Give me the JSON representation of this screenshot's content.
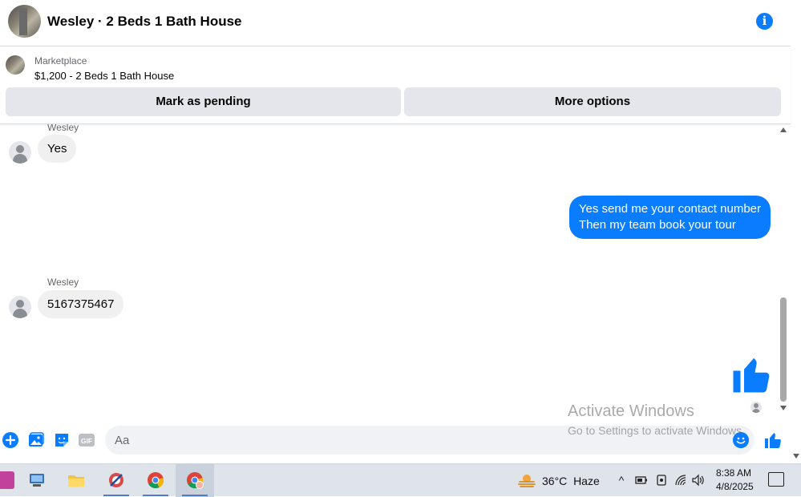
{
  "header": {
    "title": "Wesley · 2 Beds 1 Bath House",
    "info_icon": "info-icon"
  },
  "listing": {
    "source_label": "Marketplace",
    "item": "$1,200 - 2 Beds 1 Bath House",
    "buttons": {
      "pending": "Mark as pending",
      "more": "More options"
    }
  },
  "messages": [
    {
      "direction": "in",
      "sender": "Wesley",
      "text": "Yes"
    },
    {
      "direction": "out",
      "lines": [
        "Yes send me your contact number",
        "Then my team book your tour"
      ]
    },
    {
      "direction": "in",
      "sender": "Wesley",
      "text": "5167375467"
    },
    {
      "direction": "out",
      "type": "like",
      "icon": "thumbs-up-icon"
    }
  ],
  "composer": {
    "placeholder": "Aa",
    "icons": [
      "plus-icon",
      "image-icon",
      "sticker-icon",
      "gif-icon",
      "emoji-icon",
      "thumbs-up-icon"
    ]
  },
  "watermark": {
    "line1": "Activate Windows",
    "line2": "Go to Settings to activate Windows."
  },
  "taskbar": {
    "weather": {
      "temp": "36°C",
      "condition": "Haze"
    },
    "time": "8:38 AM",
    "date": "4/8/2025"
  },
  "colors": {
    "accent": "#0a7cff",
    "bubble_in": "#f0f0f0",
    "button_bg": "#e4e6eb"
  }
}
